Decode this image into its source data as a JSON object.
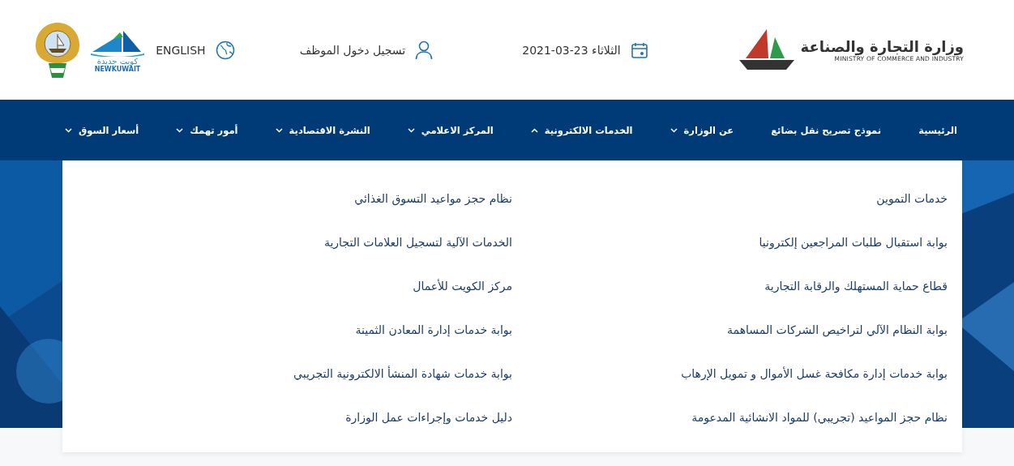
{
  "header": {
    "logo": {
      "title": "وزارة التجارة والصناعة",
      "subtitle": "MINISTRY OF COMMERCE AND INDUSTRY"
    },
    "date": "الثلاثاء 23-03-2021",
    "login": "تسجيل دخول الموظف",
    "language": "ENGLISH",
    "campaign_logo": {
      "arabic": "كويت جديدة",
      "latin": "NEWKUWAIT"
    }
  },
  "nav": [
    {
      "label": "الرئيسية",
      "kind": "link"
    },
    {
      "label": "نموذج تصريح نقل بضائع",
      "kind": "link"
    },
    {
      "label": "عن الوزارة",
      "kind": "menu",
      "expanded": false
    },
    {
      "label": "الخدمات الالكترونية",
      "kind": "menu",
      "expanded": true
    },
    {
      "label": "المركز الاعلامي",
      "kind": "menu",
      "expanded": false
    },
    {
      "label": "النشرة الاقتصادية",
      "kind": "menu",
      "expanded": false
    },
    {
      "label": "أمور تهمك",
      "kind": "menu",
      "expanded": false
    },
    {
      "label": "أسعار السوق",
      "kind": "menu",
      "expanded": false
    }
  ],
  "dropdown": {
    "columns": [
      [
        "خدمات التموين",
        "بوابة استقبال طلبات المراجعين إلكترونيا",
        "قطاع حماية المستهلك والرقابة التجارية",
        "بوابة النظام الآلي لتراخيص الشركات المساهمة",
        "بوابة خدمات إدارة مكافحة غسل الأموال و تمويل الإرهاب",
        "نظام حجز المواعيد (تجريبي) للمواد الانشائية المدعومة"
      ],
      [
        "نظام حجز مواعيد التسوق الغذائي",
        "الخدمات الآلية لتسجيل العلامات التجارية",
        "مركز الكويت للأعمال",
        "بوابة خدمات إدارة المعادن الثمينة",
        "بوابة خدمات شهادة المنشأ الالكترونية التجريبي",
        "دليل خدمات وإجراءات عمل الوزارة"
      ]
    ]
  }
}
